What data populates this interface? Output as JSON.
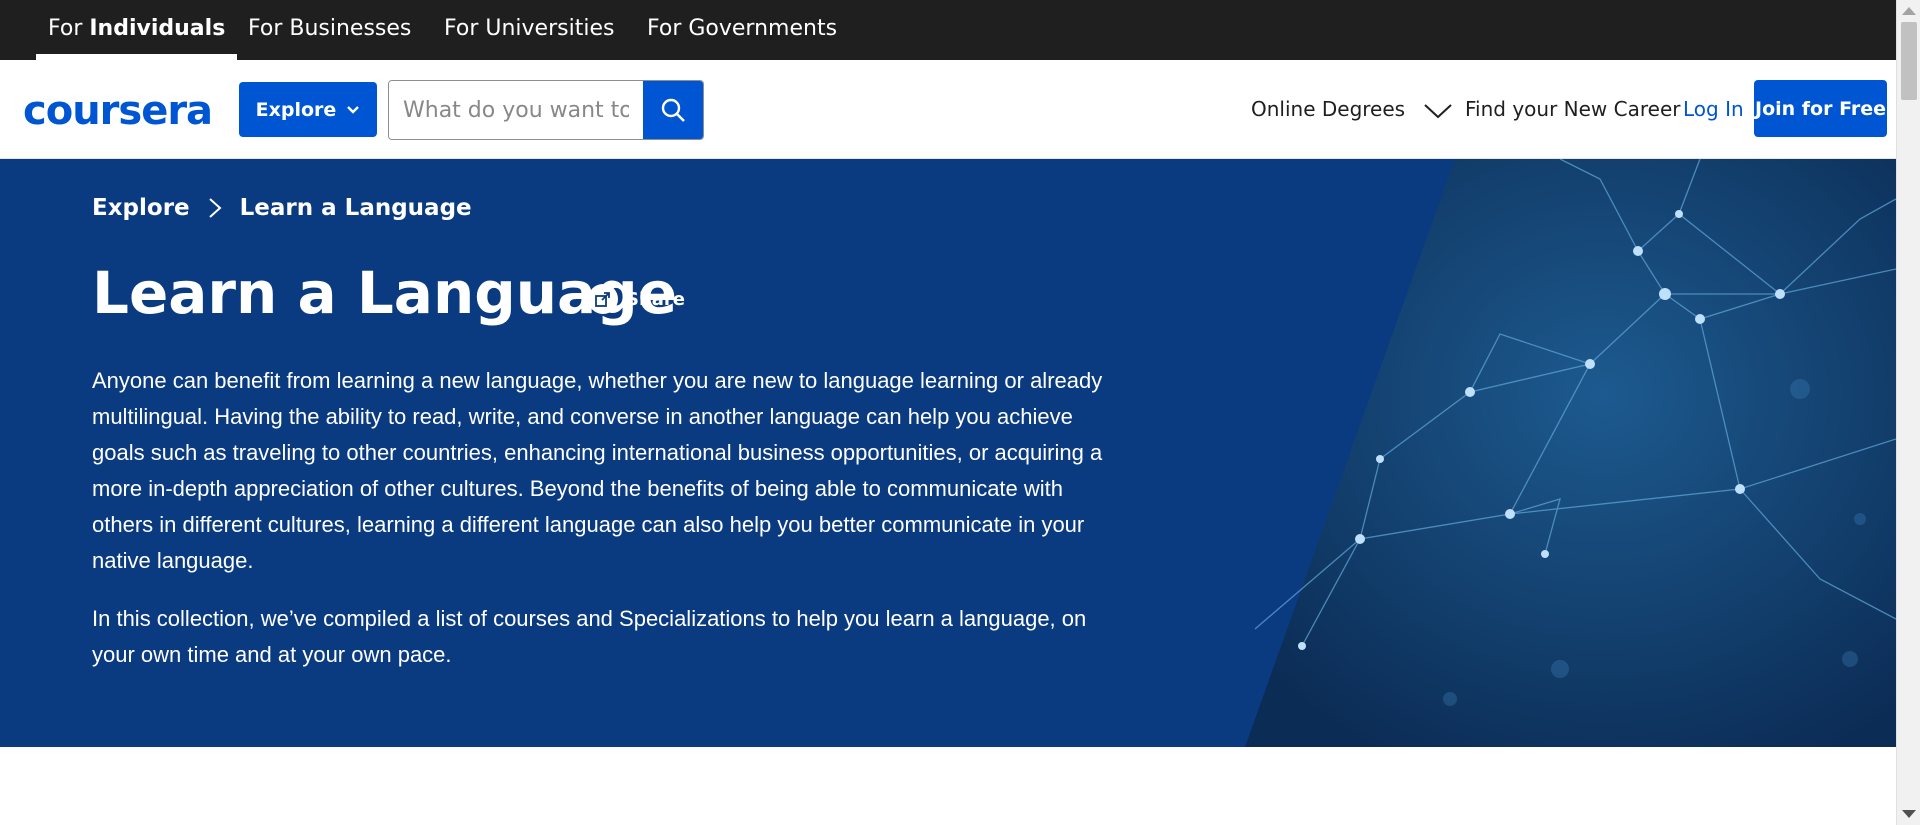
{
  "topbar": {
    "tabs": [
      {
        "prefix": "For ",
        "bold": "Individuals",
        "active": true
      },
      {
        "label": "For Businesses"
      },
      {
        "label": "For Universities"
      },
      {
        "label": "For Governments"
      }
    ]
  },
  "header": {
    "logo": "coursera",
    "explore_label": "Explore",
    "search_placeholder": "What do you want to learn?",
    "online_degrees": "Online Degrees",
    "find_career": "Find your New Career",
    "login": "Log In",
    "join": "Join for Free"
  },
  "hero": {
    "breadcrumb": [
      "Explore",
      "Learn a Language"
    ],
    "title": "Learn a Language",
    "share": "Share",
    "paragraph1": "Anyone can benefit from learning a new language, whether you are new to language learning or already multilingual. Having the ability to read, write, and converse in another language can help you achieve goals such as traveling to other countries, enhancing international business opportunities, or acquiring a more in-depth appreciation of other cultures. Beyond the benefits of being able to communicate with others in different cultures, learning a different language can also help you better communicate in your native language.",
    "paragraph2": "In this collection, we’ve compiled a list of courses and Specializations to help you learn a language, on your own time and at your own pace."
  },
  "colors": {
    "brand": "#0056d2",
    "topbar_bg": "#1f1f1f",
    "hero_bg": "#0a3b80"
  }
}
